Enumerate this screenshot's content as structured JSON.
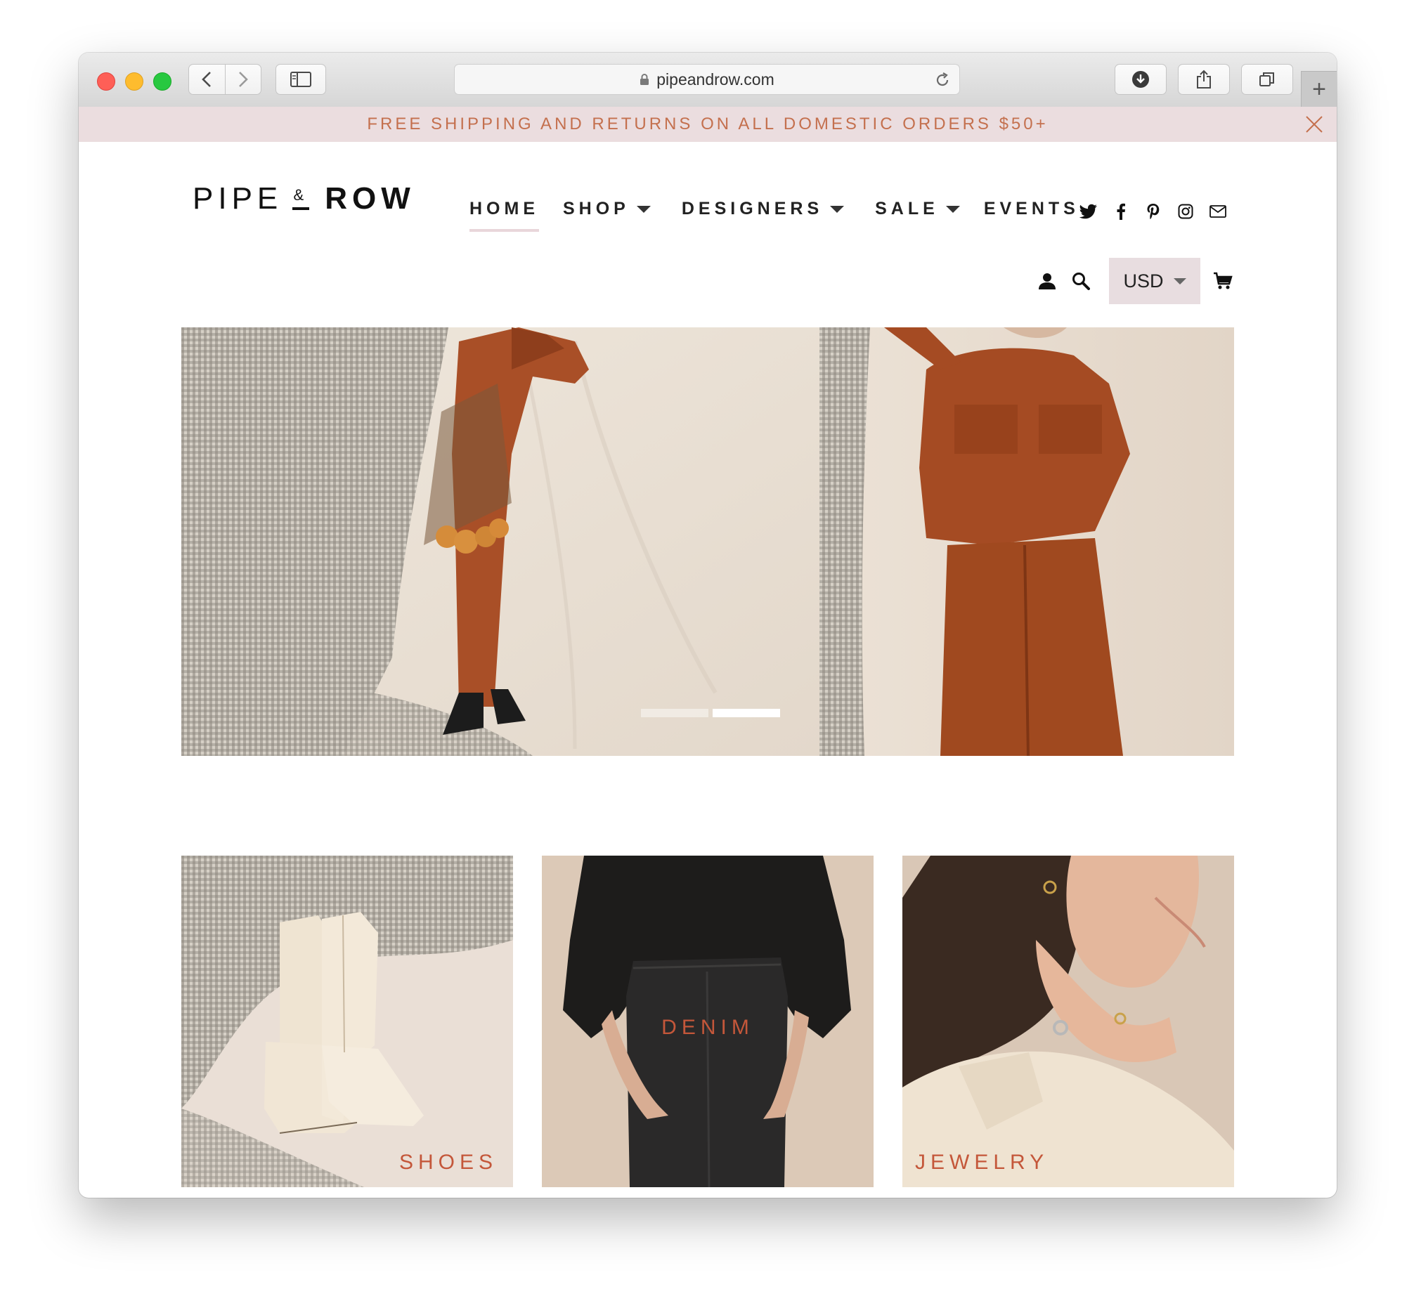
{
  "browser": {
    "url": "pipeandrow.com",
    "newtab_symbol": "+"
  },
  "promo": {
    "text": "FREE SHIPPING AND RETURNS ON ALL DOMESTIC ORDERS $50+"
  },
  "logo": {
    "left": "PIPE",
    "amp": "&",
    "right": "ROW"
  },
  "nav": {
    "items": [
      "HOME",
      "SHOP",
      "DESIGNERS",
      "SALE",
      "EVENTS"
    ]
  },
  "socials": [
    "twitter-icon",
    "facebook-icon",
    "pinterest-icon",
    "instagram-icon",
    "mail-icon"
  ],
  "utility": {
    "currency": "USD"
  },
  "hero": {
    "slide_count": 2,
    "active_slide": 2
  },
  "categories": [
    {
      "label": "SHOES"
    },
    {
      "label": "DENIM"
    },
    {
      "label": "JEWELRY"
    }
  ],
  "colors": {
    "accent": "#c4573a",
    "promo_bg": "#ebdddf",
    "currency_bg": "#e8dde0"
  }
}
